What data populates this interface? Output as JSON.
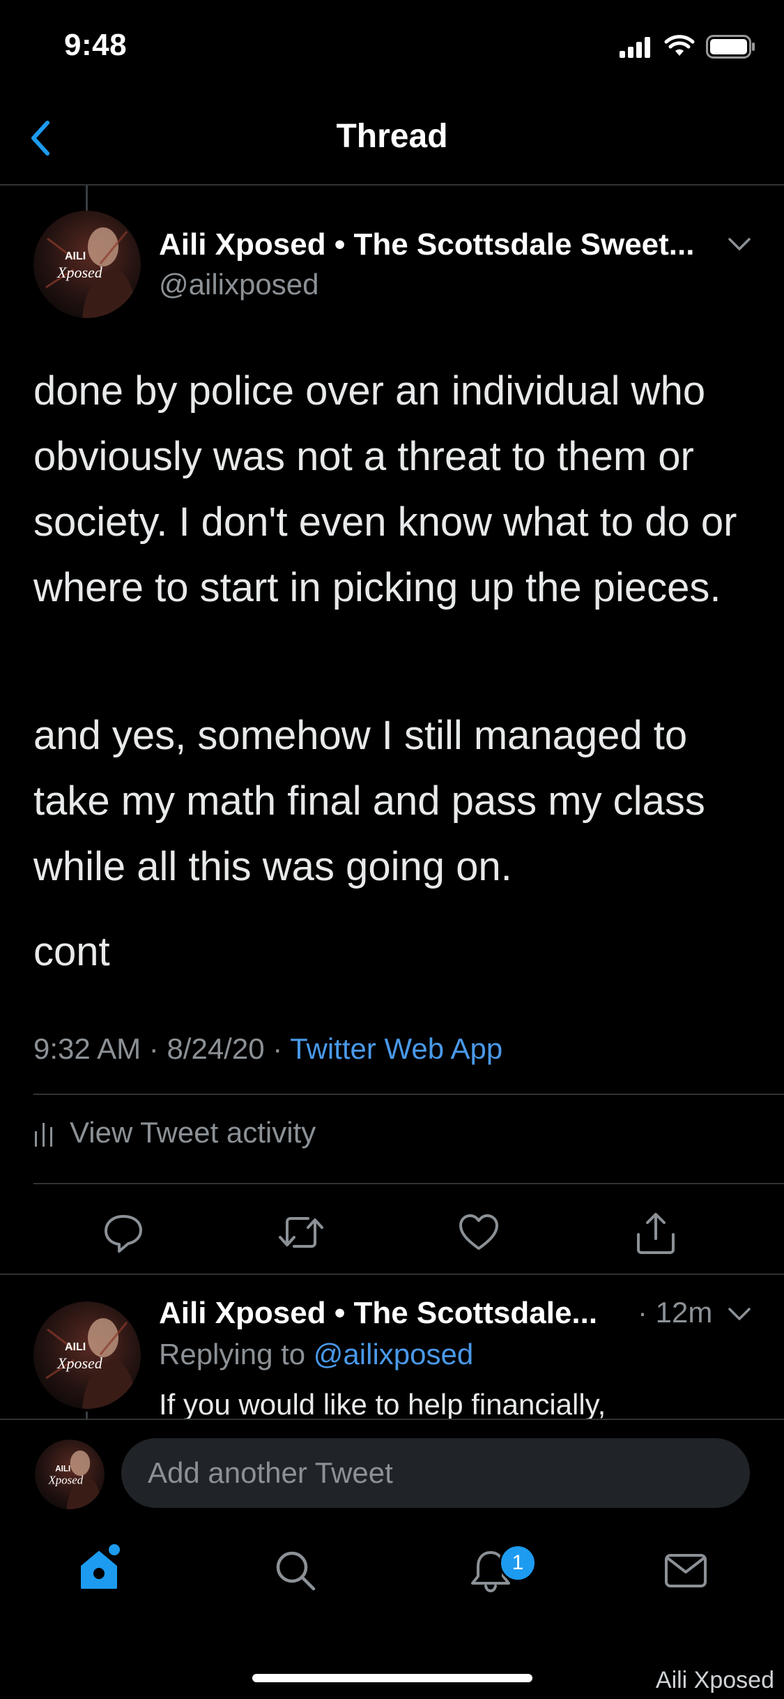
{
  "status_bar": {
    "time": "9:48"
  },
  "nav": {
    "title": "Thread"
  },
  "main_tweet": {
    "author_name": "Aili Xposed • The Scottsdale Sweet...",
    "handle": "@ailixposed",
    "paragraphs": [
      "done by police over an individual who obviously was not a threat to them or society. I don't even know what to do or where to start in picking up the pieces.",
      "and yes, somehow I still managed to take my math final and pass my class while all this was going on.",
      "cont"
    ],
    "time": "9:32 AM",
    "date": "8/24/20",
    "source": "Twitter Web App",
    "activity_label": "View Tweet activity"
  },
  "avatar_text": {
    "line1": "AILI",
    "line2": "Xposed"
  },
  "reply_tweet": {
    "author_name": "Aili Xposed • The Scottsdale...",
    "time": "· 12m",
    "replying_prefix": "Replying to",
    "replying_handle": "@ailixposed",
    "text": "If you would like to help financially,"
  },
  "compose": {
    "placeholder": "Add another Tweet"
  },
  "tab_bar": {
    "notifications_badge": "1"
  },
  "watermark": "Aili Xposed",
  "colors": {
    "accent": "#1d9bf0",
    "link": "#4a99e9",
    "muted": "#8b9196"
  }
}
